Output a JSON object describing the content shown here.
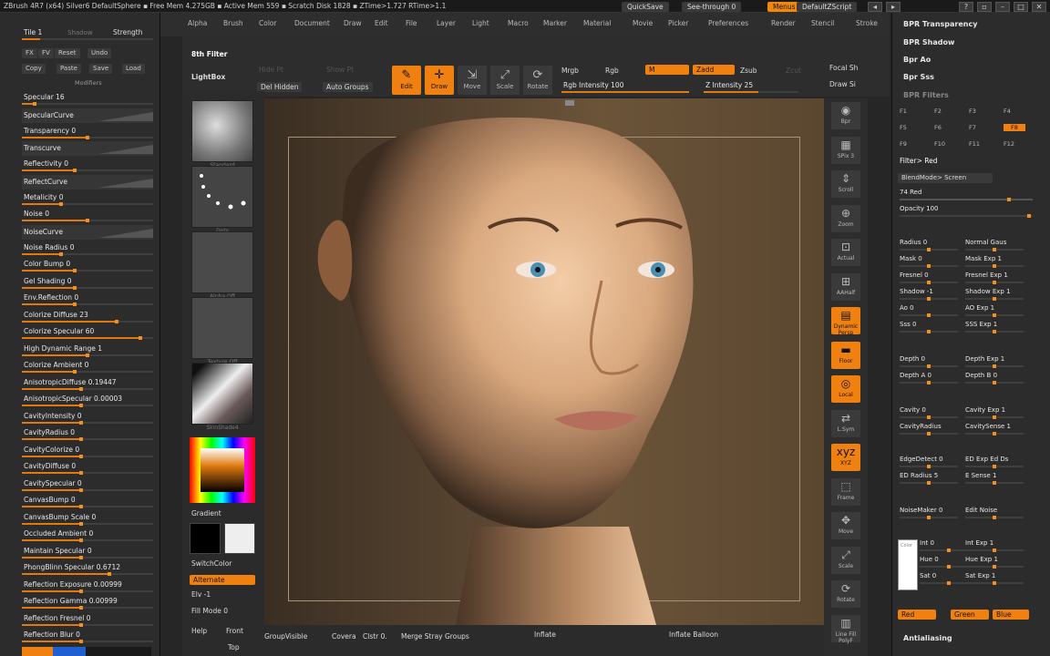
{
  "titlebar": {
    "text": "ZBrush 4R7 (x64) Silver6   DefaultSphere   ▪ Free Mem 4.275GB ▪ Active Mem 559 ▪ Scratch Disk 1828 ▪ ZTime>1.727 RTime>1.1",
    "quicksave": "QuickSave",
    "seethrough": "See-through  0",
    "menus": "Menus",
    "script": "DefaultZScript"
  },
  "menubar": [
    "Alpha",
    "Brush",
    "Color",
    "Document",
    "Draw",
    "Edit",
    "File",
    "Layer",
    "Light",
    "Macro",
    "Marker",
    "Material",
    "Movie",
    "Picker",
    "Preferences",
    "Render",
    "Stencil",
    "Stroke",
    "Texture",
    "Tool",
    "Transform",
    "Zoom",
    "Zplugin"
  ],
  "left": {
    "header": {
      "tile": "Tile 1",
      "shadow": "Shadow",
      "strength": "Strength",
      "buttons": [
        "FX",
        "FV",
        "Reset",
        "Undo"
      ],
      "buttons2": [
        "Copy",
        "Paste",
        "Save",
        "Load"
      ],
      "modifiers": "Modifiers"
    },
    "sliders": [
      {
        "label": "Specular 16",
        "v": 0.1
      },
      {
        "curve": "SpecularCurve"
      },
      {
        "label": "Transparency 0",
        "v": 0.5
      },
      {
        "curve": "Transcurve"
      },
      {
        "label": "Reflectivity 0",
        "v": 0.4
      },
      {
        "curve": "ReflectCurve"
      },
      {
        "label": "Metalicity 0",
        "v": 0.3
      },
      {
        "label": "Noise 0",
        "v": 0.5
      },
      {
        "curve": "NoiseCurve"
      },
      {
        "label": "Noise Radius 0",
        "v": 0.3
      },
      {
        "label": "Color Bump 0",
        "v": 0.4
      },
      {
        "label": "Gel Shading 0",
        "v": 0.4
      },
      {
        "label": "Env.Reflection 0",
        "v": 0.4
      },
      {
        "label": "Colorize Diffuse 23",
        "v": 0.72
      },
      {
        "label": "Colorize Specular 60",
        "v": 0.9
      },
      {
        "label": "High Dynamic Range 1",
        "v": 0.5
      },
      {
        "label": "Colorize Ambient 0",
        "v": 0.4
      },
      {
        "label": "AnisotropicDiffuse 0.19447",
        "v": 0.45
      },
      {
        "label": "AnisotropicSpecular 0.00003",
        "v": 0.45
      },
      {
        "label": "CavityIntensity 0",
        "v": 0.45
      },
      {
        "label": "CavityRadius 0",
        "v": 0.45
      },
      {
        "label": "CavityColorize 0",
        "v": 0.45
      },
      {
        "label": "CavityDiffuse 0",
        "v": 0.45
      },
      {
        "label": "CavitySpecular 0",
        "v": 0.45
      },
      {
        "label": "CanvasBump 0",
        "v": 0.45
      },
      {
        "label": "CanvasBump Scale 0",
        "v": 0.45
      },
      {
        "label": "Occluded Ambient 0",
        "v": 0.45
      },
      {
        "label": "Maintain Specular 0",
        "v": 0.45
      },
      {
        "label": "PhongBlinn Specular 0.6712",
        "v": 0.67
      },
      {
        "label": "Reflection Exposure 0.00999",
        "v": 0.45
      },
      {
        "label": "Reflection Gamma 0.00999",
        "v": 0.45
      },
      {
        "label": "Reflection Fresnel 0",
        "v": 0.45
      },
      {
        "label": "Reflection Blur 0",
        "v": 0.45
      }
    ]
  },
  "toolbar": {
    "subpalette": "8th Filter",
    "lightbox": "LightBox",
    "hide_pt": "Hide Pt",
    "unhide": "Show Pt",
    "del_hidden": "Del Hidden",
    "auto_groups": "Auto Groups",
    "edit": "Edit",
    "draw": "Draw",
    "move": "Move",
    "scale": "Scale",
    "rotate": "Rotate",
    "mrgb": "Mrgb",
    "rgb": "Rgb",
    "m": "M",
    "zadd": "Zadd",
    "zsub": "Zsub",
    "zcut": "Zcut",
    "rgb_intensity": "Rgb Intensity 100",
    "z_intensity": "Z Intensity 25",
    "focal": "Focal Sh",
    "draw_size": "Draw Si"
  },
  "lightbox": {
    "captions": [
      "Standard",
      "Dots",
      "Alpha Off",
      "Texture Off",
      "SkinShade4"
    ],
    "gradient": "Gradient",
    "switchcolor": "SwitchColor",
    "alternate": "Alternate",
    "elv": "Elv -1",
    "fillmode": "Fill Mode 0",
    "help": "Help",
    "front": "Front",
    "top": "Top"
  },
  "bottom": {
    "groupvisible": "GroupVisible",
    "coverage": "Covera",
    "clstr": "Clstr 0.",
    "merge": "Merge Stray Groups",
    "inflate": "Inflate",
    "inflate_balloon": "Inflate Balloon"
  },
  "dock": [
    "Bpr",
    "SPix 3",
    "Scroll",
    "Zoom",
    "Actual",
    "AAHalf",
    "Dynamic Persp",
    "Floor",
    "Local",
    "L.Sym",
    "XYZ",
    "Frame",
    "Move",
    "Scale",
    "Rotate",
    "Line Fill PolyF"
  ],
  "right": {
    "headers": [
      "BPR Transparency",
      "BPR Shadow",
      "Bpr Ao",
      "Bpr Sss",
      "BPR Filters"
    ],
    "filters": [
      "F1",
      "F2",
      "F3",
      "F4",
      "F5",
      "F6",
      "F7",
      "F8",
      "F9",
      "F10",
      "F11",
      "F12"
    ],
    "filter_label": "Filter> Red",
    "blend": "BlendMode> Screen",
    "red": "74 Red",
    "opacity": "Opacity 100",
    "left_sliders": [
      "Radius 0",
      "Mask 0",
      "Fresnel 0",
      "Shadow -1",
      "Ao 0",
      "Sss 0",
      "Depth 0",
      "Depth A 0",
      "Cavity 0",
      "CavityRadius",
      "EdgeDetect 0",
      "ED Radius 5",
      "NoiseMaker 0",
      "Int 0",
      "Hue 0",
      "Sat 0"
    ],
    "right_sliders": [
      "Normal Gaus",
      "Mask Exp 1",
      "Fresnel Exp 1",
      "Shadow Exp 1",
      "AO Exp 1",
      "SSS Exp 1",
      "Depth Exp 1",
      "Depth B 0",
      "Cavity Exp 1",
      "CavitySense 1",
      "ED Exp  Ed Ds",
      "E Sense 1",
      "Edit Noise",
      "Int Exp 1",
      "Hue Exp 1",
      "Sat Exp 1"
    ],
    "color": "Color",
    "red_btn": "Red",
    "green_btn": "Green",
    "blue_btn": "Blue",
    "antialiasing": "Antialiasing"
  },
  "colors": {
    "accent": "#f08010"
  }
}
